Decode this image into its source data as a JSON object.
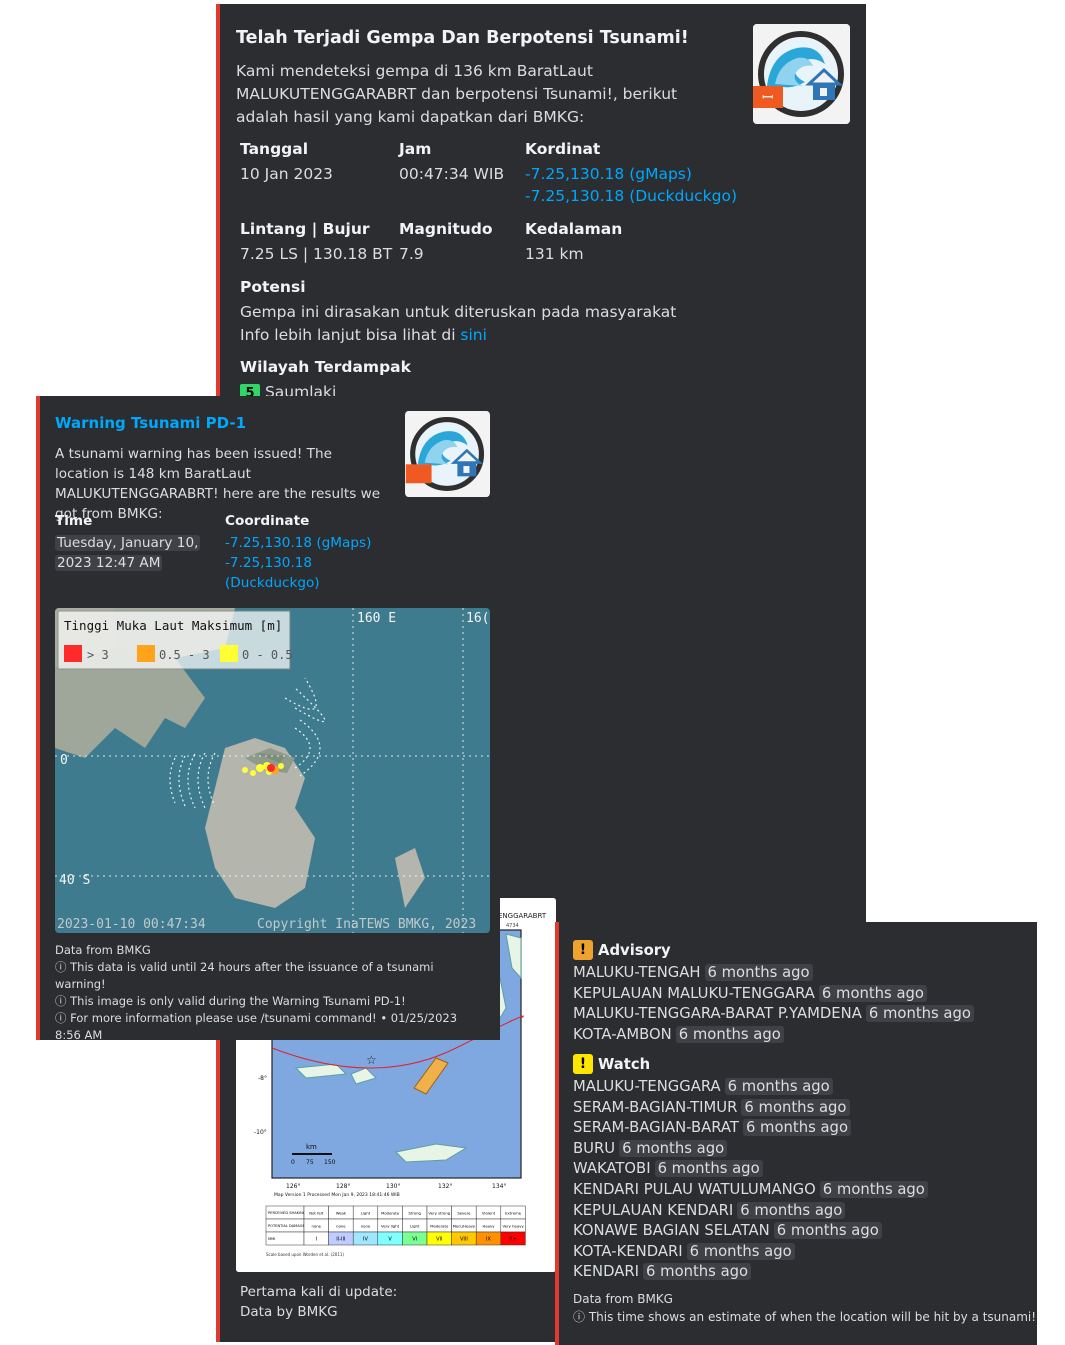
{
  "card1": {
    "title": "Telah Terjadi Gempa Dan Berpotensi Tsunami!",
    "description": "Kami mendeteksi gempa di 136 km BaratLaut MALUKUTENGGARABRT dan berpotensi Tsunami!, berikut adalah hasil yang kami dapatkan dari BMKG:",
    "fields": {
      "tanggal_label": "Tanggal",
      "tanggal_value": "10 Jan 2023",
      "jam_label": "Jam",
      "jam_value": "00:47:34 WIB",
      "kordinat_label": "Kordinat",
      "kordinat_gmaps": "-7.25,130.18 (gMaps)",
      "kordinat_ddg": "-7.25,130.18 (Duckduckgo)",
      "lintang_label": "Lintang | Bujur",
      "lintang_value": "7.25 LS | 130.18 BT",
      "magnitudo_label": "Magnitudo",
      "magnitudo_value": "7.9",
      "kedalaman_label": "Kedalaman",
      "kedalaman_value": "131 km"
    },
    "potensi_label": "Potensi",
    "potensi_line1": "Gempa ini dirasakan untuk diteruskan pada masyarakat",
    "potensi_line2_prefix": "Info lebih lanjut bisa lihat di ",
    "potensi_link": "sini",
    "wilayah_label": "Wilayah Terdampak",
    "wilayah_badge": "5",
    "wilayah_item": "Saumlaki",
    "footer_line1": "Pertama kali di update:",
    "footer_line2": "Data by BMKG"
  },
  "card2": {
    "title": "Warning Tsunami PD-1",
    "description": "A tsunami warning has been issued! The location is 148 km BaratLaut MALUKUTENGGARABRT! here are the results we got from BMKG:",
    "time_label": "Time",
    "time_value_1": "Tuesday, January 10,",
    "time_value_2": "2023 12:47 AM",
    "coord_label": "Coordinate",
    "coord_gmaps": "-7.25,130.18 (gMaps)",
    "coord_ddg_1": "-7.25,130.18",
    "coord_ddg_2": "(Duckduckgo)",
    "map": {
      "legend_title": "Tinggi Muka Laut Maksimum [m]",
      "legend_items": [
        "> 3",
        "0.5 - 3",
        "0 - 0.5"
      ],
      "legend_colors": [
        "#ff2b2b",
        "#ffa31a",
        "#ffff33"
      ],
      "lon_160": "160 E",
      "lon_16x": "16(",
      "lat_0": "0",
      "lat_40s": "40 S",
      "timestamp": "2023-01-10 00:47:34",
      "copyright": "Copyright InaTEWS BMKG, 2023"
    },
    "footer": {
      "source": "Data from BMKG",
      "note1": "This data is valid until 24 hours after the issuance of a tsunami warning!",
      "note2": "This image is only valid during the Warning Tsunami PD-1!",
      "note3": "For more information please use /tsunami command! • 01/25/2023 8:56 AM"
    }
  },
  "card3": {
    "advisory_label": "Advisory",
    "advisory": [
      {
        "name": "MALUKU-TENGAH",
        "time": "6 months ago"
      },
      {
        "name": "KEPULAUAN MALUKU-TENGGARA",
        "time": "6 months ago"
      },
      {
        "name": "MALUKU-TENGGARA-BARAT P.YAMDENA",
        "time": "6 months ago"
      },
      {
        "name": "KOTA-AMBON",
        "time": "6 months ago"
      }
    ],
    "watch_label": "Watch",
    "watch": [
      {
        "name": "MALUKU-TENGGARA",
        "time": "6 months ago"
      },
      {
        "name": "SERAM-BAGIAN-TIMUR",
        "time": "6 months ago"
      },
      {
        "name": "SERAM-BAGIAN-BARAT",
        "time": "6 months ago"
      },
      {
        "name": "BURU",
        "time": "6 months ago"
      },
      {
        "name": "WAKATOBI",
        "time": "6 months ago"
      },
      {
        "name": "KENDARI PULAU WATULUMANGO",
        "time": "6 months ago"
      },
      {
        "name": "KEPULAUAN KENDARI",
        "time": "6 months ago"
      },
      {
        "name": "KONAWE BAGIAN SELATAN",
        "time": "6 months ago"
      },
      {
        "name": "KOTA-KENDARI",
        "time": "6 months ago"
      },
      {
        "name": "KENDARI",
        "time": "6 months ago"
      }
    ],
    "footer_source": "Data from BMKG",
    "footer_note": "This time shows an estimate of when the location will be hit by a tsunami!"
  },
  "shakemap": {
    "header_text": "ENGGARABRT",
    "km_label": "km",
    "scale_labels": [
      "0",
      "75",
      "150"
    ],
    "lat_labels": [
      "-8°",
      "-10°"
    ],
    "lon_labels": [
      "126°",
      "128°",
      "130°",
      "132°",
      "134°"
    ],
    "processed_text": "Map Version 1 Processed Mon Jan 9, 2023 18:41:46 WIB",
    "table_rows": [
      "PERCEIVED SHAKING",
      "POTENTIAL DAMAGE",
      "MMI"
    ],
    "shaking": [
      "Not felt",
      "Weak",
      "Light",
      "Moderate",
      "Strong",
      "Very strong",
      "Severe",
      "Violent",
      "Extreme"
    ],
    "damage": [
      "none",
      "none",
      "none",
      "Very light",
      "Light",
      "Moderate",
      "Mod./Heavy",
      "Heavy",
      "Very heavy"
    ],
    "mmi": [
      "I",
      "II-III",
      "IV",
      "V",
      "VI",
      "VII",
      "VIII",
      "IX",
      "X+"
    ],
    "mmi_colors": [
      "#ffffff",
      "#bfccff",
      "#a0e6ff",
      "#80ffff",
      "#7aff93",
      "#ffff00",
      "#ffc800",
      "#ff9100",
      "#ff0000"
    ],
    "scale_note": "Scale based upon Worden et al. (2011)"
  },
  "colors": {
    "card_bg": "#2b2d31",
    "bar_red": "#e03a2e",
    "link": "#00a8fc",
    "advisory_icon": "#f0a22f",
    "watch_icon": "#ffe600",
    "badge_green": "#2fd668"
  }
}
